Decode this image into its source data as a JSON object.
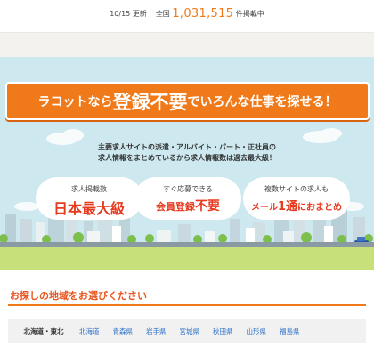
{
  "stats": {
    "date": "10/15 更新",
    "label_total": "全国",
    "count": "1,031,515",
    "suffix": "件掲載中"
  },
  "hero": {
    "headline_a": "ラコットなら",
    "headline_em": "登録不要",
    "headline_b": "でいろんな仕事を探せる！",
    "desc_line1": "主要求人サイトの派遣・アルバイト・パート・正社員の",
    "desc_line2": "求人情報をまとめているから求人情報数は過去最大級！",
    "bubbles": [
      {
        "line1": "求人掲載数",
        "line2": "日本最大級"
      },
      {
        "line1": "すぐ応募できる",
        "line2a": "会員登録",
        "line2b": "不要"
      },
      {
        "line1": "複数サイトの求人も",
        "line2a": "メール",
        "line2b": "1通",
        "line2c": "におまとめ"
      }
    ]
  },
  "area": {
    "title": "お探しの地域をお選びください",
    "region": "北海道・東北",
    "prefectures": [
      "北海道",
      "青森県",
      "岩手県",
      "宮城県",
      "秋田県",
      "山形県",
      "福島県"
    ]
  },
  "colors": {
    "accent": "#f07a1a",
    "emphasis_red": "#e6391e",
    "link_blue": "#2a6fc9",
    "sky": "#cde8ef",
    "grass": "#c8e07a"
  }
}
